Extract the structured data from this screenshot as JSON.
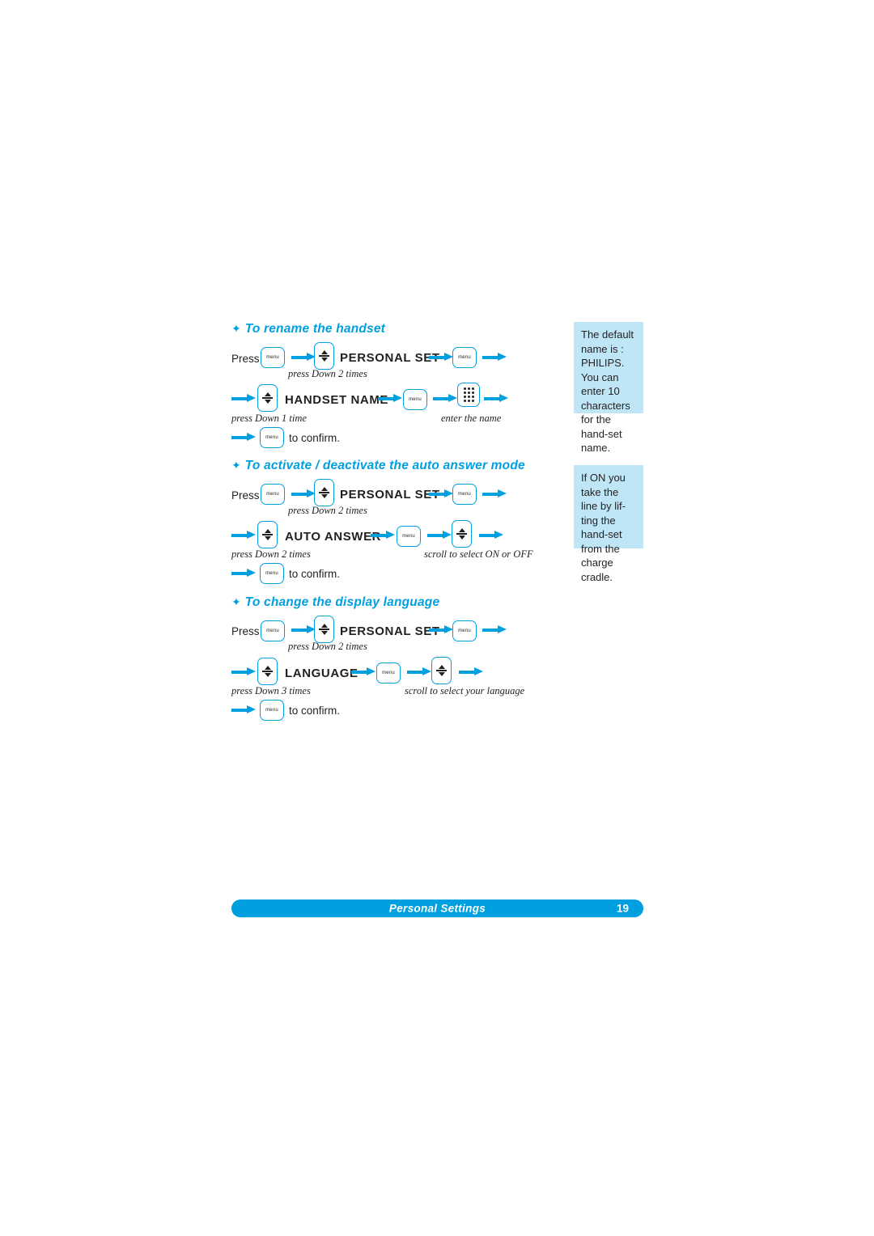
{
  "page": {
    "footer_title": "Personal Settings",
    "footer_page": "19"
  },
  "sections": [
    {
      "title": "To rename the handset",
      "press_label": "Press",
      "step_labels": {
        "down2": "press Down 2 times",
        "down1": "press Down  1 time",
        "enter_name": "enter the name",
        "confirm": "to confirm."
      },
      "menu_items": {
        "personal_set": "PERSONAL SET",
        "handset_name": "HANDSET NAME"
      }
    },
    {
      "title": "To activate / deactivate the auto answer mode",
      "press_label": "Press",
      "step_labels": {
        "down2a": "press Down 2 times",
        "down2b": "press Down  2 times",
        "scroll": "scroll to select ON or OFF",
        "confirm": "to confirm."
      },
      "menu_items": {
        "personal_set": "PERSONAL SET",
        "auto_answer": "AUTO ANSWER"
      }
    },
    {
      "title": "To change the display language",
      "press_label": "Press",
      "step_labels": {
        "down2": "press Down 2 times",
        "down3": "press Down  3 times",
        "scroll": "scroll to select your language",
        "confirm": "to confirm."
      },
      "menu_items": {
        "personal_set": "PERSONAL SET",
        "language": "LANGUAGE"
      }
    }
  ],
  "notes": [
    {
      "id": "note-default-name",
      "text": "The default name is : PHILIPS. You can enter 10 characters for the hand-set name."
    },
    {
      "id": "note-auto-answer",
      "text": "If ON you take the line by lif-ting the hand-set from the charge cradle."
    }
  ],
  "icons": {
    "menu_key": "menu-key-icon",
    "nav_key": "navigation-key-icon",
    "keypad_key": "keypad-icon",
    "arrow": "arrow-right-icon",
    "bullet": "diamond-bullet-icon"
  },
  "colors": {
    "accent": "#00a0e0",
    "note_bg": "#bfe6f7",
    "text": "#231f20"
  }
}
